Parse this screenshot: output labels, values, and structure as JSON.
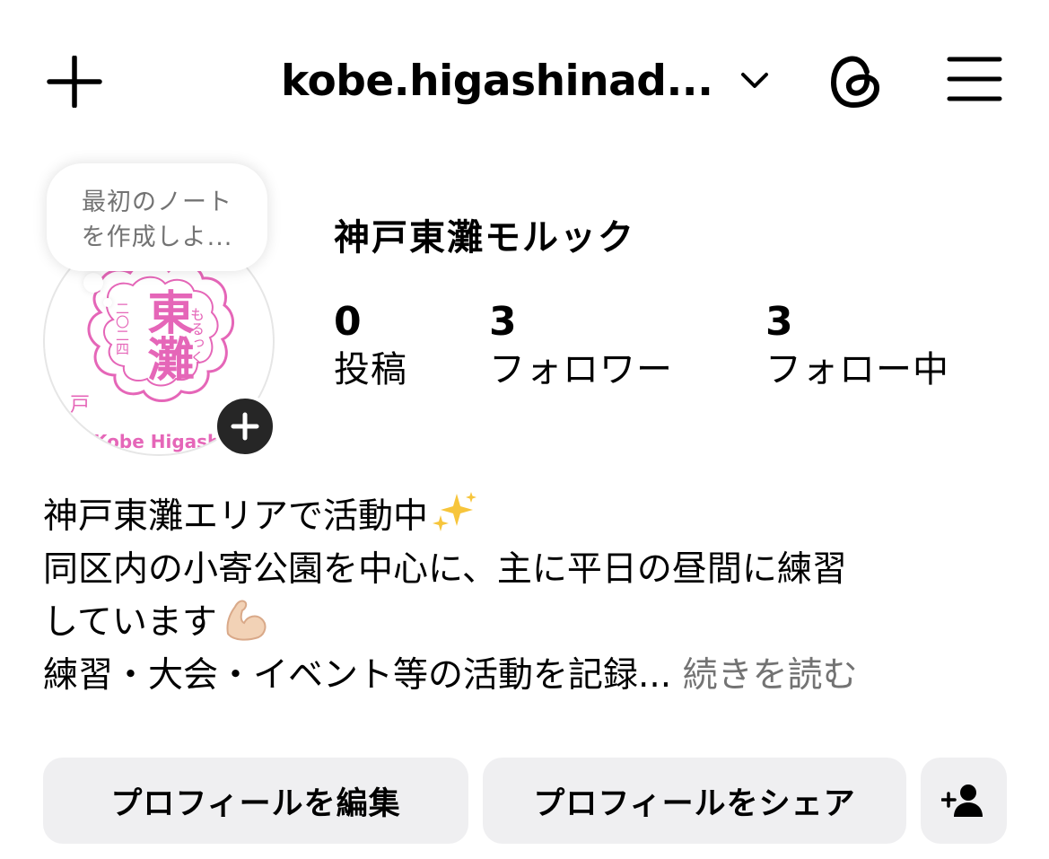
{
  "header": {
    "username": "kobe.higashinad...",
    "new_icon": "plus-icon",
    "switch_icon": "chevron-down-icon",
    "threads_icon": "threads-icon",
    "menu_icon": "hamburger-menu-icon"
  },
  "note": {
    "text": "最初のノート\nを作成しよ..."
  },
  "avatar": {
    "logo_text": "東灘",
    "logo_side_text": "もるっく",
    "logo_year_text": "二〇二四",
    "logo_left_text": "戸",
    "logo_bottom_text": "Kobe Higashinad",
    "logo_color": "#e566b8",
    "add_icon": "plus-icon"
  },
  "profile": {
    "display_name": "神戸東灘モルック",
    "stats": [
      {
        "count": "0",
        "label": "投稿"
      },
      {
        "count": "3",
        "label": "フォロワー"
      },
      {
        "count": "3",
        "label": "フォロー中"
      }
    ]
  },
  "bio": {
    "line1": "神戸東灘エリアで活動中",
    "line1_emoji": "sparkles-emoji",
    "line2": "同区内の小寄公園を中心に、主に平日の昼間に練習",
    "line3": "しています",
    "line3_emoji": "flexed-biceps-emoji",
    "line4": "練習・大会・イベント等の活動を記録...",
    "more": "続きを読む"
  },
  "actions": {
    "edit_profile": "プロフィールを編集",
    "share_profile": "プロフィールをシェア",
    "discover_icon": "add-person-icon"
  },
  "colors": {
    "button_bg": "#efeff1",
    "muted_text": "#737373",
    "dark_badge": "#262626"
  }
}
